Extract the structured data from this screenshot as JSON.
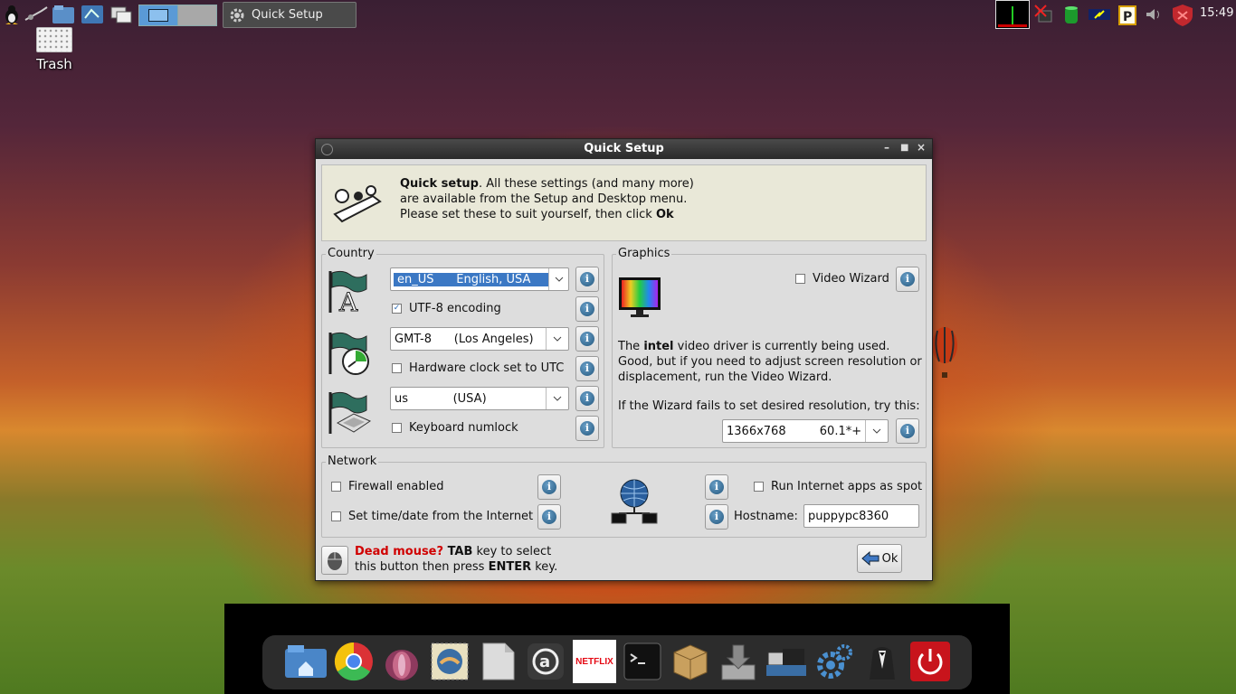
{
  "panel": {
    "task_label": "Quick Setup",
    "clock": "15:49"
  },
  "desktop": {
    "trash_label": "Trash"
  },
  "window": {
    "title": "Quick Setup",
    "intro": {
      "bold": "Quick setup",
      "line1_rest": ". All these settings (and many more)",
      "line2": "are available from the Setup and Desktop menu.",
      "line3_pre": "Please set these to suit yourself, then click ",
      "line3_bold": "Ok"
    },
    "country": {
      "legend": "Country",
      "locale_value": "en_US      English, USA",
      "utf8_label": "UTF-8 encoding",
      "utf8_checked": true,
      "timezone_value": "GMT-8      (Los Angeles)",
      "hwclock_label": "Hardware clock set to UTC",
      "hwclock_checked": false,
      "keyboard_value": "us            (USA)",
      "numlock_label": "Keyboard numlock",
      "numlock_checked": false
    },
    "graphics": {
      "legend": "Graphics",
      "wizard_label": "Video Wizard",
      "wizard_checked": false,
      "driver_pre": "The ",
      "driver_bold": "intel",
      "driver_rest": " video driver is currently being used.",
      "driver_line2": "Good, but if you need to adjust screen resolution or",
      "driver_line3": "displacement, run the Video Wizard.",
      "fallback_text": "If the Wizard fails to set desired resolution, try this:",
      "resolution_value": "1366x768         60.1*+"
    },
    "network": {
      "legend": "Network",
      "firewall_label": "Firewall enabled",
      "firewall_checked": false,
      "timesync_label": "Set time/date from the Internet",
      "timesync_checked": false,
      "spot_label": "Run Internet apps as spot",
      "spot_checked": false,
      "hostname_label": "Hostname:",
      "hostname_value": "puppypc8360"
    },
    "footer": {
      "dead_mouse": "Dead mouse?",
      "tab_key": " TAB",
      "line1_rest": " key to select",
      "line2_pre": "this button then press ",
      "enter_key": "ENTER",
      "line2_rest": " key.",
      "ok_label": "Ok"
    },
    "info_glyph": "i"
  },
  "dock": {
    "netflix_label": "NETFLIX"
  }
}
